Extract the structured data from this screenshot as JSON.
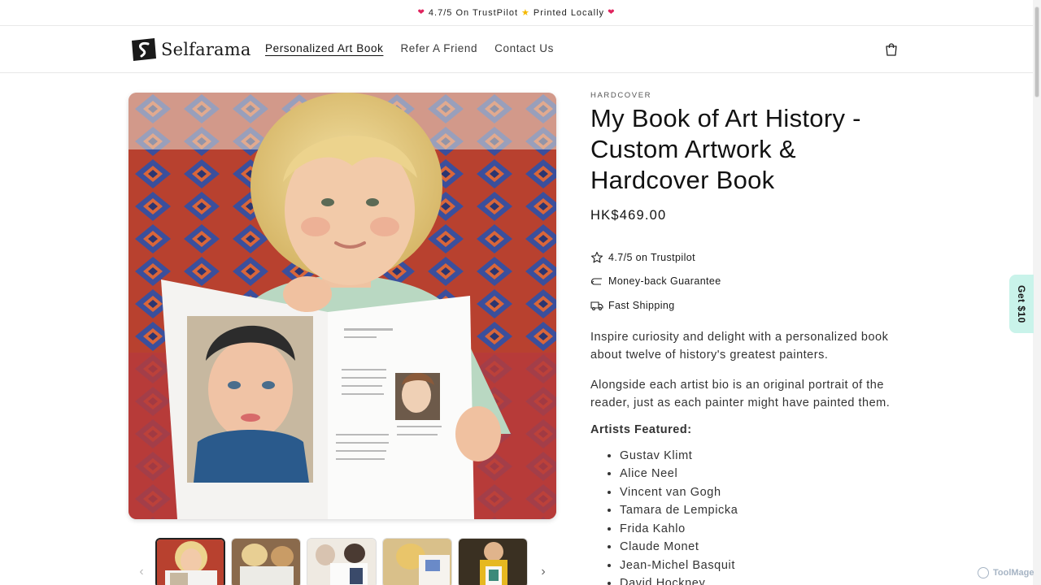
{
  "announcement": {
    "left_emoji": "heart-icon",
    "text_part1": "4.7/5 On TrustPilot",
    "middle_emoji": "star-icon",
    "text_part2": "Printed Locally",
    "right_emoji": "heart-icon"
  },
  "header": {
    "logo_text": "Selfarama",
    "nav": [
      {
        "label": "Personalized Art Book",
        "active": true
      },
      {
        "label": "Refer A Friend",
        "active": false
      },
      {
        "label": "Contact Us",
        "active": false
      }
    ],
    "cart_icon": "shopping-bag-icon"
  },
  "gallery": {
    "main_image": "child-holding-open-book-photo",
    "thumbnails": [
      {
        "name": "thumb-child-with-book",
        "selected": true
      },
      {
        "name": "thumb-two-children-reading",
        "selected": false
      },
      {
        "name": "thumb-grandparent-reading",
        "selected": false
      },
      {
        "name": "thumb-child-yellow-shirt",
        "selected": false
      },
      {
        "name": "thumb-portrait-page",
        "selected": false
      }
    ],
    "prev_icon": "chevron-left-icon",
    "next_icon": "chevron-right-icon"
  },
  "product": {
    "vendor": "HARDCOVER",
    "title": "My Book of Art History - Custom Artwork & Hardcover Book",
    "price": "HK$469.00",
    "badges": [
      {
        "icon": "star-outline-icon",
        "text": "4.7/5 on Trustpilot"
      },
      {
        "icon": "return-arrow-icon",
        "text": "Money-back Guarantee"
      },
      {
        "icon": "truck-icon",
        "text": "Fast Shipping"
      }
    ],
    "description": [
      "Inspire curiosity and delight with a personalized book about twelve of history's greatest painters.",
      "Alongside each artist bio is an original portrait of the reader, just as each painter might have painted them."
    ],
    "artists_heading": "Artists Featured:",
    "artists": [
      "Gustav Klimt",
      "Alice Neel",
      "Vincent van Gogh",
      "Tamara de Lempicka",
      "Frida Kahlo",
      "Claude Monet",
      "Jean-Michel Basquit",
      "David Hockney"
    ]
  },
  "side_tab": {
    "label": "Get $10"
  },
  "watermark": {
    "text": "ToolMage"
  },
  "colors": {
    "side_tab_bg": "#c9f3ea",
    "heart": "#e0245e",
    "star": "#f5b800"
  }
}
